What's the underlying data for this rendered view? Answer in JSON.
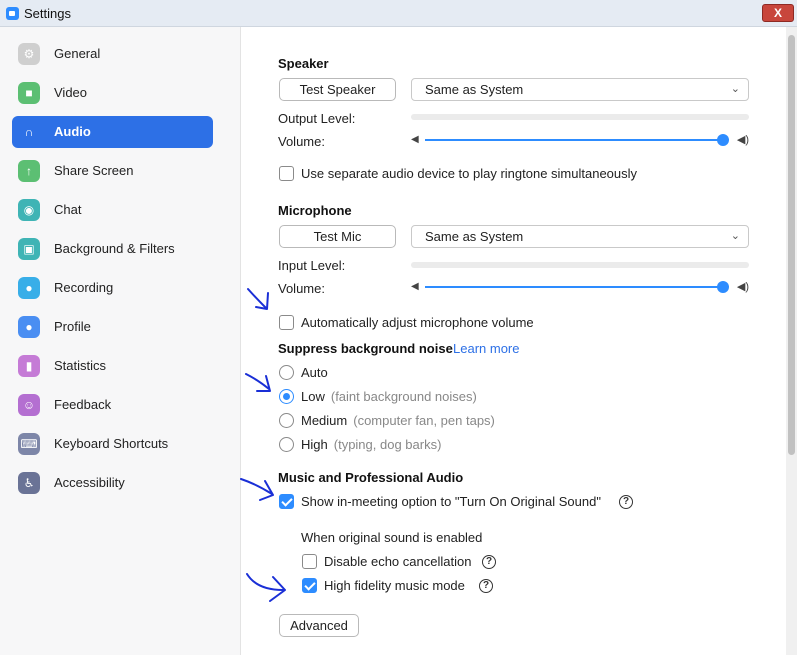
{
  "window": {
    "title": "Settings",
    "close_label": "X"
  },
  "sidebar": {
    "items": [
      {
        "label": "General",
        "icon": "gear-icon",
        "color": "#cfcfcf",
        "glyph": "⚙"
      },
      {
        "label": "Video",
        "icon": "video-camera-icon",
        "color": "#5cbf73",
        "glyph": "■"
      },
      {
        "label": "Audio",
        "icon": "headphones-icon",
        "color": "#2d70e6",
        "glyph": "∩",
        "active": true
      },
      {
        "label": "Share Screen",
        "icon": "share-screen-icon",
        "color": "#5cbf73",
        "glyph": "↑"
      },
      {
        "label": "Chat",
        "icon": "chat-bubble-icon",
        "color": "#3fb4b5",
        "glyph": "◉"
      },
      {
        "label": "Background & Filters",
        "icon": "background-icon",
        "color": "#3fb4b5",
        "glyph": "▣"
      },
      {
        "label": "Recording",
        "icon": "record-icon",
        "color": "#38aee8",
        "glyph": "●"
      },
      {
        "label": "Profile",
        "icon": "profile-icon",
        "color": "#4a8ef2",
        "glyph": "●"
      },
      {
        "label": "Statistics",
        "icon": "statistics-icon",
        "color": "#c57bd6",
        "glyph": "▮"
      },
      {
        "label": "Feedback",
        "icon": "feedback-smile-icon",
        "color": "#b46fd1",
        "glyph": "☺"
      },
      {
        "label": "Keyboard Shortcuts",
        "icon": "keyboard-icon",
        "color": "#7d86a8",
        "glyph": "⌨"
      },
      {
        "label": "Accessibility",
        "icon": "accessibility-icon",
        "color": "#6a7396",
        "glyph": "♿"
      }
    ]
  },
  "speaker": {
    "heading": "Speaker",
    "test_button": "Test Speaker",
    "device": "Same as System",
    "output_level_label": "Output Level:",
    "volume_label": "Volume:",
    "volume_fraction": 1.0
  },
  "ringtone_checkbox": {
    "label": "Use separate audio device to play ringtone simultaneously",
    "checked": false
  },
  "microphone": {
    "heading": "Microphone",
    "test_button": "Test Mic",
    "device": "Same as System",
    "input_level_label": "Input Level:",
    "volume_label": "Volume:",
    "volume_fraction": 1.0
  },
  "auto_adjust_checkbox": {
    "label": "Automatically adjust microphone volume",
    "checked": false
  },
  "noise": {
    "heading": "Suppress background noise",
    "learn_more": "Learn more",
    "options": [
      {
        "label": "Auto",
        "hint": "",
        "checked": false
      },
      {
        "label": "Low",
        "hint": "(faint background noises)",
        "checked": true
      },
      {
        "label": "Medium",
        "hint": "(computer fan, pen taps)",
        "checked": false
      },
      {
        "label": "High",
        "hint": "(typing, dog barks)",
        "checked": false
      }
    ]
  },
  "music": {
    "heading": "Music and Professional Audio",
    "original_sound_option": {
      "label": "Show in-meeting option to \"Turn On Original Sound\"",
      "checked": true
    },
    "when_enabled_label": "When original sound is enabled",
    "echo_option": {
      "label": "Disable echo cancellation",
      "checked": false
    },
    "hifi_option": {
      "label": "High fidelity music mode",
      "checked": true
    },
    "help_glyph": "?"
  },
  "advanced_button": "Advanced",
  "colors": {
    "accent": "#2d8cff",
    "active_nav": "#2d70e6",
    "annotation_ink": "#1a2fd6"
  }
}
